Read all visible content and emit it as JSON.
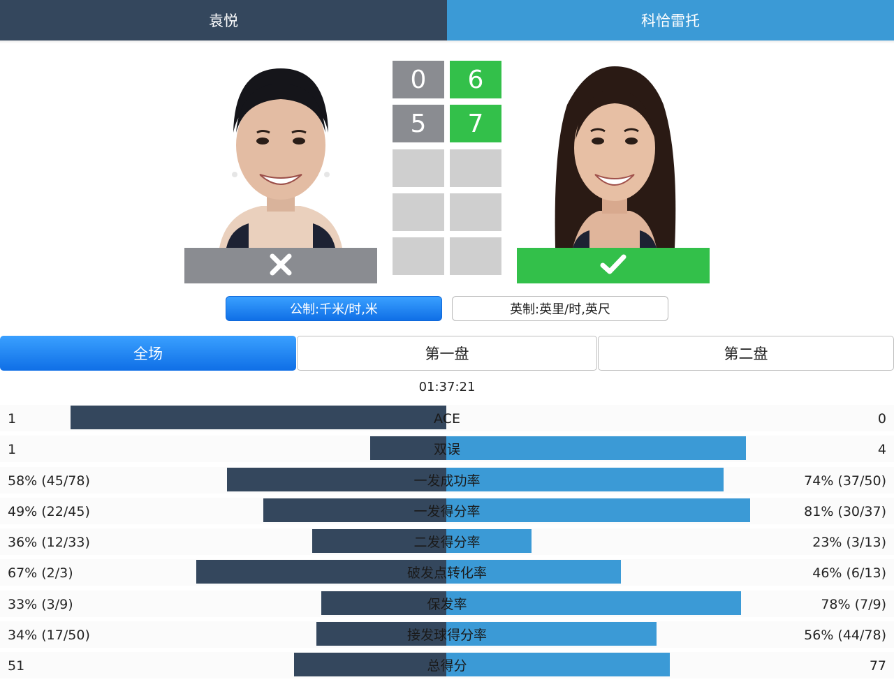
{
  "players": {
    "p1_name": "袁悦",
    "p2_name": "科恰雷托",
    "p1_result_icon": "close-icon",
    "p2_result_icon": "check-icon"
  },
  "colors": {
    "p1": "#34475d",
    "p2": "#3b9ad6",
    "win": "#33c04a",
    "loss": "#8a8c91",
    "empty": "#cfcfcf",
    "accent": "#1a7ff0"
  },
  "score": {
    "p1_sets": [
      "0",
      "5"
    ],
    "p2_sets": [
      "6",
      "7"
    ]
  },
  "units": {
    "metric": "公制:千米/时,米",
    "imperial": "英制:英里/时,英尺"
  },
  "tabs": [
    "全场",
    "第一盘",
    "第二盘"
  ],
  "duration": "01:37:21",
  "stats": [
    {
      "label": "ACE",
      "left": "1",
      "right": "0",
      "left_frac": 0.84,
      "right_frac": 0.0
    },
    {
      "label": "双误",
      "left": "1",
      "right": "4",
      "left_frac": 0.17,
      "right_frac": 0.67
    },
    {
      "label": "一发成功率",
      "left": "58% (45/78)",
      "right": "74% (37/50)",
      "left_frac": 0.49,
      "right_frac": 0.62
    },
    {
      "label": "一发得分率",
      "left": "49% (22/45)",
      "right": "81% (30/37)",
      "left_frac": 0.41,
      "right_frac": 0.68
    },
    {
      "label": "二发得分率",
      "left": "36% (12/33)",
      "right": "23% (3/13)",
      "left_frac": 0.3,
      "right_frac": 0.19
    },
    {
      "label": "破发点转化率",
      "left": "67% (2/3)",
      "right": "46% (6/13)",
      "left_frac": 0.56,
      "right_frac": 0.39
    },
    {
      "label": "保发率",
      "left": "33% (3/9)",
      "right": "78% (7/9)",
      "left_frac": 0.28,
      "right_frac": 0.66
    },
    {
      "label": "接发球得分率",
      "left": "34% (17/50)",
      "right": "56% (44/78)",
      "left_frac": 0.29,
      "right_frac": 0.47
    },
    {
      "label": "总得分",
      "left": "51",
      "right": "77",
      "left_frac": 0.34,
      "right_frac": 0.5
    }
  ]
}
